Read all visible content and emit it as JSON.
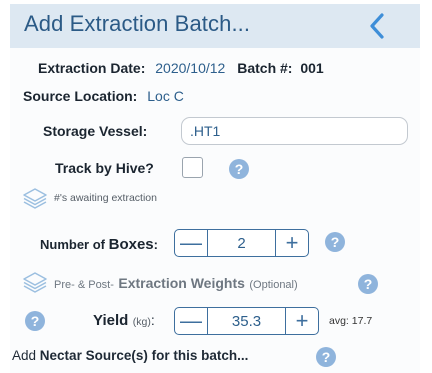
{
  "header": {
    "title": "Add Extraction Batch...",
    "back_icon": "chevron-left-icon",
    "accent": "#3e8ed8",
    "background": "#dde8f2"
  },
  "extraction": {
    "date_label": "Extraction Date:",
    "date_value": "2020/10/12",
    "batch_label": "Batch #:",
    "batch_value": "001"
  },
  "source": {
    "label": "Source Location:",
    "value": "Loc C"
  },
  "storage": {
    "label": "Storage Vessel:",
    "value": ".HT1"
  },
  "hive": {
    "label": "Track by Hive?",
    "checked": false
  },
  "awaiting": {
    "icon": "layers-icon",
    "text": "#'s awaiting extraction"
  },
  "boxes": {
    "label_prefix": "Number of",
    "label_main": "Boxes",
    "label_suffix": ":",
    "value": "2",
    "minus": "—",
    "plus": "+"
  },
  "weights": {
    "prefix": "Pre- & Post-",
    "main": "Extraction Weights",
    "suffix": "(Optional)"
  },
  "yield": {
    "label": "Yield",
    "unit": "(kg)",
    "colon": ":",
    "value": "35.3",
    "minus": "—",
    "plus": "+",
    "avg": "avg: 17.7"
  },
  "nectar": {
    "prefix": "Add",
    "main": "Nectar Source(s)",
    "suffix": "for this batch..."
  },
  "colors": {
    "button_blue": "#3e6f9e",
    "help_badge": "#8fb4dc",
    "value_text": "#2d5f8c"
  }
}
